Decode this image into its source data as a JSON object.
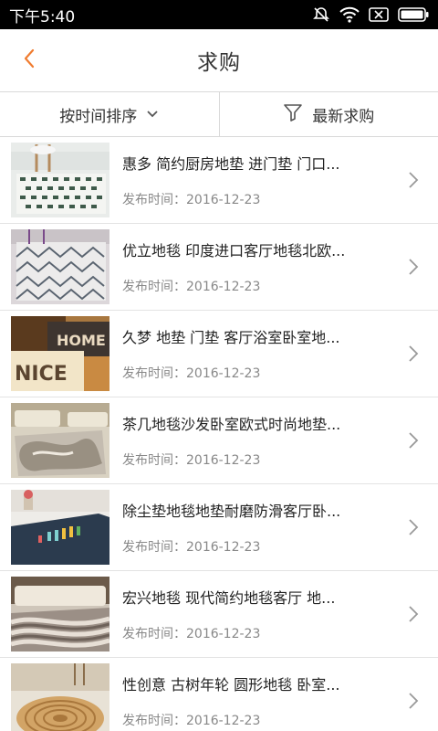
{
  "status_bar": {
    "time": "下午5:40"
  },
  "header": {
    "title": "求购"
  },
  "filters": [
    {
      "label": "按时间排序"
    },
    {
      "label": "最新求购"
    }
  ],
  "date_label": "发布时间：",
  "items": [
    {
      "title": "惠多 简约厨房地垫 进门垫 门口...",
      "date": "2016-12-23"
    },
    {
      "title": "优立地毯 印度进口客厅地毯北欧...",
      "date": "2016-12-23"
    },
    {
      "title": "久梦 地垫 门垫 客厅浴室卧室地...",
      "date": "2016-12-23"
    },
    {
      "title": "茶几地毯沙发卧室欧式时尚地垫...",
      "date": "2016-12-23"
    },
    {
      "title": "除尘垫地毯地垫耐磨防滑客厅卧...",
      "date": "2016-12-23"
    },
    {
      "title": "宏兴地毯 现代简约地毯客厅 地...",
      "date": "2016-12-23"
    },
    {
      "title": "性创意 古树年轮 圆形地毯 卧室...",
      "date": "2016-12-23"
    }
  ],
  "colors": {
    "accent": "#f07c30",
    "status_bar": "#000000",
    "divider": "#d9d9d9"
  },
  "icons": [
    "mute-icon",
    "wifi-icon",
    "sim-card-icon",
    "battery-icon",
    "back-arrow-icon",
    "chevron-down-icon",
    "filter-funnel-icon",
    "chevron-right-icon"
  ]
}
